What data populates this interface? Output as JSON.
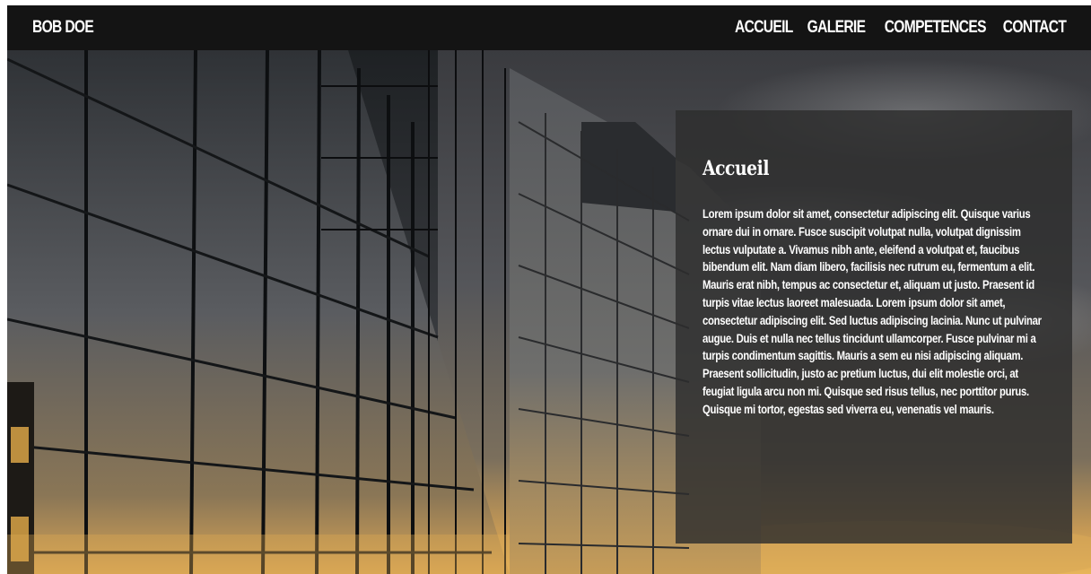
{
  "header": {
    "brand": "BOB DOE",
    "nav": [
      "ACCUEIL",
      "GALERIE",
      "COMPETENCES",
      "CONTACT"
    ]
  },
  "section": {
    "title": "Accueil",
    "body": "Lorem ipsum dolor sit amet, consectetur adipiscing elit. Quisque varius ornare dui in ornare. Fusce suscipit volutpat nulla, volutpat dignissim lectus vulputate a. Vivamus nibh ante, eleifend a volutpat et, faucibus bibendum elit. Nam diam libero, facilisis nec rutrum eu, fermentum a elit. Mauris erat nibh, tempus ac consectetur et, aliquam ut justo. Praesent id turpis vitae lectus laoreet malesuada. Lorem ipsum dolor sit amet, consectetur adipiscing elit. Sed luctus adipiscing lacinia. Nunc ut pulvinar augue. Duis et nulla nec tellus tincidunt ullamcorper. Fusce pulvinar mi a turpis condimentum sagittis. Mauris a sem eu nisi adipiscing aliquam. Praesent sollicitudin, justo ac pretium luctus, dui elit molestie orci, at feugiat ligula arcu non mi. Quisque sed risus tellus, nec porttitor purus. Quisque mi tortor, egestas sed viverra eu, venenatis vel mauris."
  },
  "colors": {
    "header_bg": "#141414",
    "panel_bg": "#2d2d2d",
    "text": "#ffffff",
    "sunset": "#e8b55a"
  }
}
